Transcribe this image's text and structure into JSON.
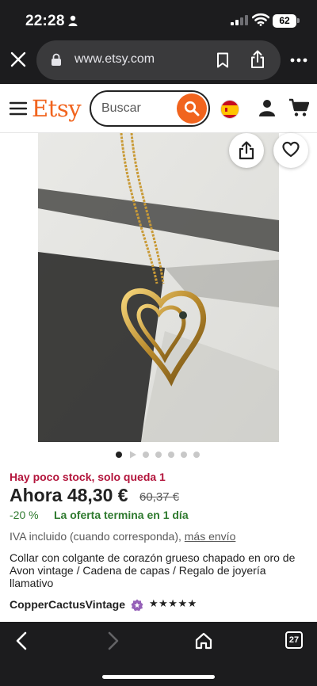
{
  "status_bar": {
    "time": "22:28",
    "battery": "62"
  },
  "browser": {
    "url": "www.etsy.com",
    "tab_count": "27"
  },
  "etsy_header": {
    "logo": "Etsy",
    "search_placeholder": "Buscar"
  },
  "product": {
    "stock_notice": "Hay poco stock, solo queda 1",
    "price_now": "Ahora 48,30 €",
    "price_old": "60,37 €",
    "discount": "-20 %",
    "offer_notice": "La oferta termina en 1 día",
    "vat_note": "IVA incluido (cuando corresponda),",
    "shipping_link": "más envío",
    "title": "Collar con colgante de corazón grueso chapado en oro de Avon vintage / Cadena de capas / Regalo de joyería llamativo",
    "shop_name": "CopperCactusVintage",
    "rating_stars": "★★★★★",
    "image_count": 6,
    "current_image": 1
  },
  "colors": {
    "etsy_orange": "#f1641e",
    "stock_red": "#b3153c",
    "offer_green": "#2f7a2f"
  }
}
